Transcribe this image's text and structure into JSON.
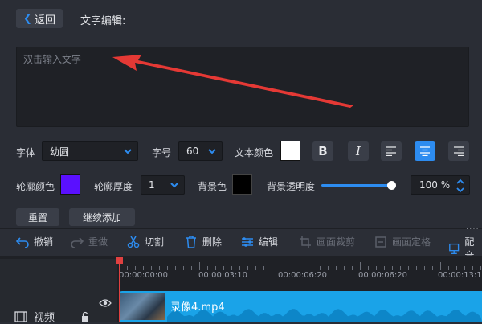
{
  "header": {
    "back_label": "返回",
    "title": "文字编辑:"
  },
  "text_input": {
    "placeholder": "双击输入文字"
  },
  "font_row": {
    "font_label": "字体",
    "font_value": "幼圆",
    "size_label": "字号",
    "size_value": "60",
    "color_label": "文本颜色",
    "text_color": "#ffffff",
    "bold": "B",
    "italic": "I"
  },
  "outline_row": {
    "outline_color_label": "轮廓颜色",
    "outline_color": "#5a10ff",
    "thickness_label": "轮廓厚度",
    "thickness_value": "1",
    "bg_label": "背景色",
    "bg_color": "#000000",
    "opacity_label": "背景透明度",
    "opacity_value": "100 %",
    "opacity_level": 1.0
  },
  "actions": {
    "reset": "重置",
    "continue_add": "继续添加"
  },
  "toolbar": {
    "undo": "撤销",
    "redo": "重做",
    "cut": "切割",
    "delete": "删除",
    "edit": "编辑",
    "crop": "画面裁剪",
    "freeze": "画面定格",
    "dub": "配音"
  },
  "timeline": {
    "ticks": [
      "00:00:00:00",
      "00:00:03:10",
      "00:00:06:20",
      "00:00:06:20",
      "00:00:13:10"
    ],
    "clip_name": "录像4.mp4",
    "track_label": "视频"
  },
  "colors": {
    "accent": "#2d8cf0",
    "clip": "#1aa3e8",
    "arrow": "#e53935"
  }
}
